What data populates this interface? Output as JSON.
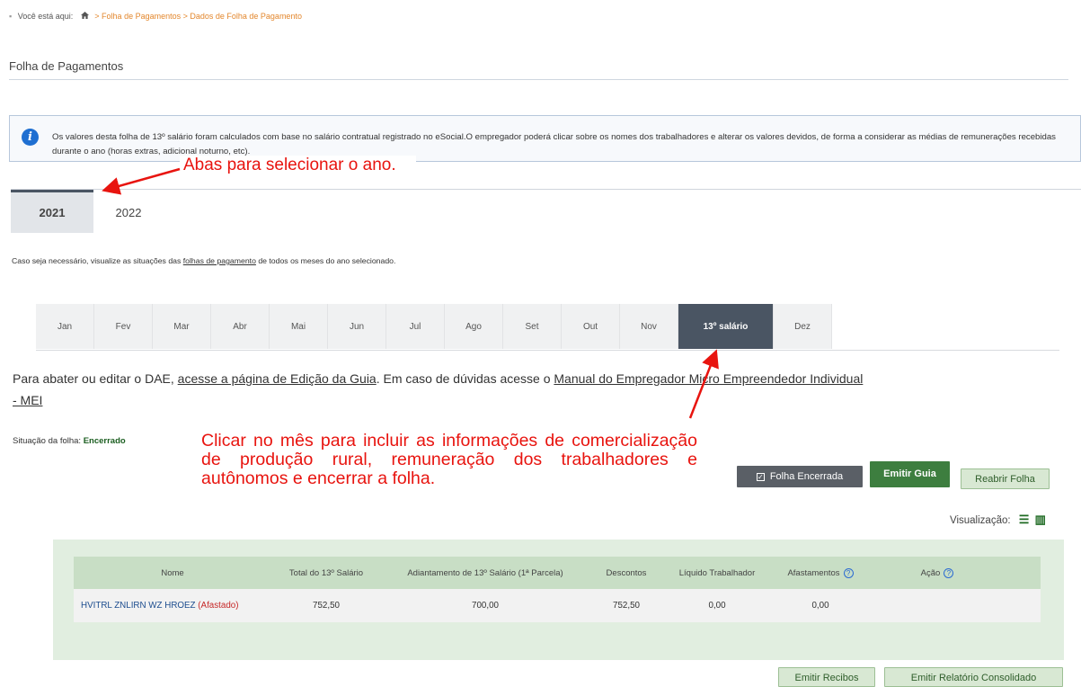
{
  "breadcrumb": {
    "prefix": "Você está aqui:",
    "path": "> Folha de Pagamentos > Dados de Folha de Pagamento"
  },
  "page_title": "Folha de Pagamentos",
  "info": {
    "text": "Os valores desta folha de 13º salário foram calculados com base no salário contratual registrado no eSocial.O empregador poderá clicar sobre os nomes dos trabalhadores e alterar os valores devidos, de forma a considerar as médias de remunerações recebidas durante o ano (horas extras, adicional noturno, etc)."
  },
  "annotations": {
    "tabs": "Abas para selecionar o ano.",
    "month": "Clicar no mês para incluir as informações de comercialização de produção rural, remuneração dos trabalhadores e autônomos e encerrar a folha."
  },
  "year_tabs": [
    "2021",
    "2022"
  ],
  "help_line": {
    "before": "Caso seja necessário, visualize as situações das ",
    "link": "folhas de pagamento",
    "after": " de todos os meses do ano selecionado."
  },
  "months": [
    "Jan",
    "Fev",
    "Mar",
    "Abr",
    "Mai",
    "Jun",
    "Jul",
    "Ago",
    "Set",
    "Out",
    "Nov",
    "13º salário",
    "Dez"
  ],
  "dae": {
    "t1": "Para abater ou editar o DAE, ",
    "link1": "acesse a página de Edição da Guia",
    "t2": ". Em caso de dúvidas acesse o ",
    "link2": "Manual do Empregador Micro Empreendedor Individual",
    "line2": "- MEI"
  },
  "situacao": {
    "label": "Situação da folha:",
    "value": "Encerrado"
  },
  "buttons": {
    "folha_encerrada": "Folha Encerrada",
    "emitir_guia": "Emitir Guia",
    "reabrir_folha": "Reabrir Folha",
    "emitir_recibos": "Emitir Recibos",
    "emitir_relatorio": "Emitir Relatório Consolidado"
  },
  "visualizacao": "Visualização:",
  "table": {
    "headers": [
      "Nome",
      "Total do 13º Salário",
      "Adiantamento de 13º Salário (1ª Parcela)",
      "Descontos",
      "Líquido Trabalhador",
      "Afastamentos",
      "Ação"
    ],
    "rows": [
      {
        "nome": "HVITRL ZNLIRN WZ HROEZ",
        "status": "(Afastado)",
        "total": "752,50",
        "adiantamento": "700,00",
        "descontos": "752,50",
        "liquido": "0,00",
        "afastamentos": "0,00"
      }
    ]
  }
}
